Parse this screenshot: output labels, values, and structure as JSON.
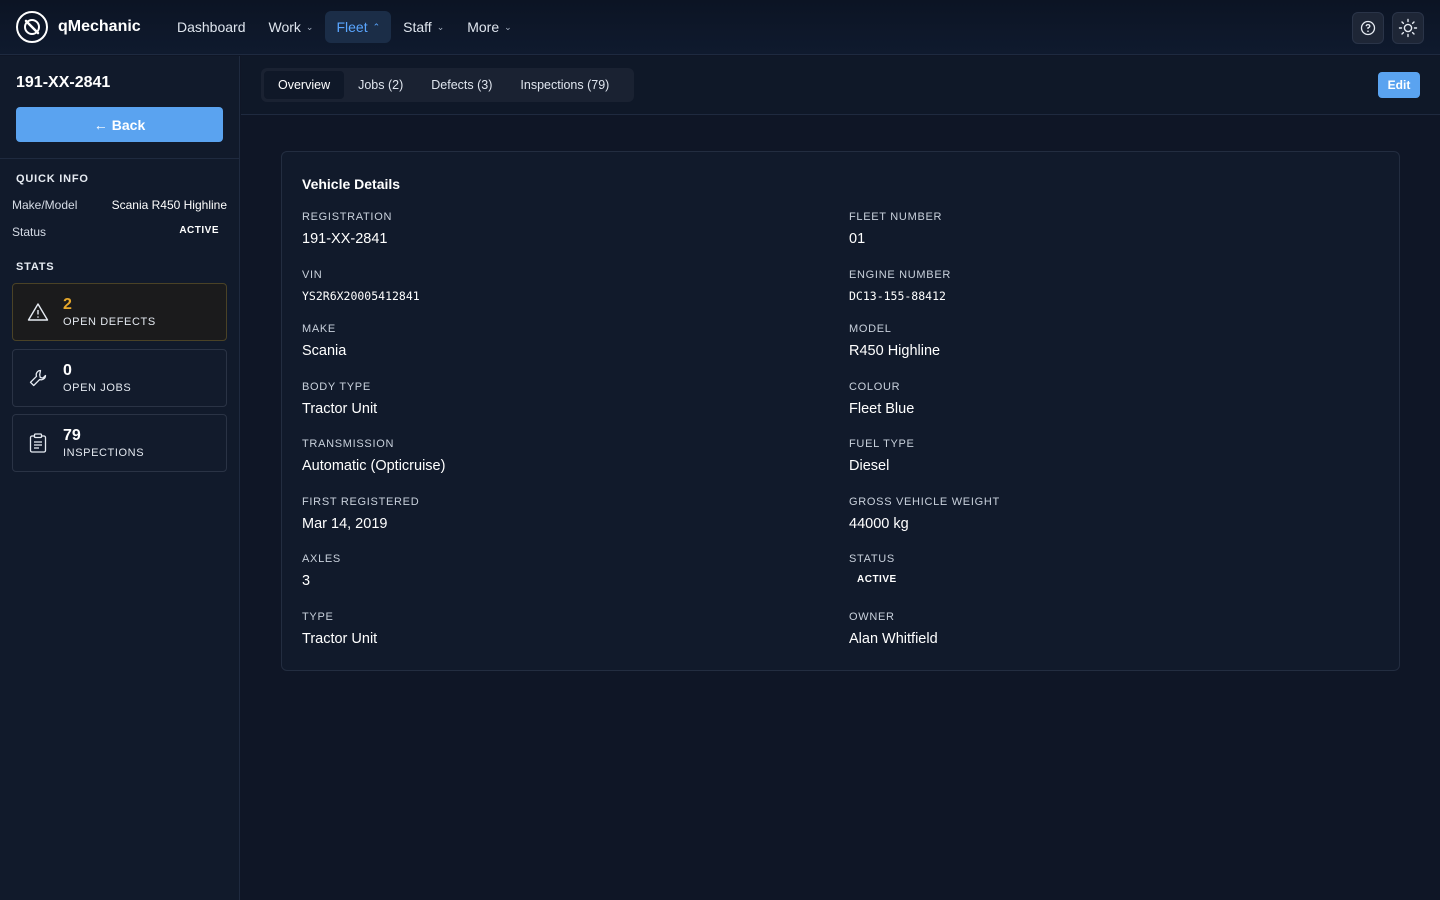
{
  "app": {
    "brand": "qMechanic",
    "nav": [
      {
        "label": "Dashboard",
        "has_menu": false,
        "active": false
      },
      {
        "label": "Work",
        "has_menu": true,
        "active": false
      },
      {
        "label": "Fleet",
        "has_menu": true,
        "active": true
      },
      {
        "label": "Staff",
        "has_menu": true,
        "active": false
      },
      {
        "label": "More",
        "has_menu": true,
        "active": false
      }
    ]
  },
  "sidebar": {
    "title": "191-XX-2841",
    "back_label": "Back",
    "quick_info_heading": "QUICK INFO",
    "quick_info": [
      {
        "key": "Make/Model",
        "value": "Scania R450 Highline"
      },
      {
        "key": "Status",
        "value": "ACTIVE"
      }
    ],
    "stats_heading": "STATS",
    "stats": [
      {
        "number": "2",
        "label": "OPEN DEFECTS",
        "icon": "warning-icon"
      },
      {
        "number": "0",
        "label": "OPEN JOBS",
        "icon": "wrench-icon"
      },
      {
        "number": "79",
        "label": "INSPECTIONS",
        "icon": "clipboard-icon"
      }
    ]
  },
  "tabs": [
    "Overview",
    "Jobs (2)",
    "Defects (3)",
    "Inspections (79)"
  ],
  "active_tab": "Overview",
  "edit_label": "Edit",
  "details": {
    "title": "Vehicle Details",
    "left": [
      {
        "key": "REGISTRATION",
        "value": "191-XX-2841"
      },
      {
        "key": "VIN",
        "value": "YS2R6X20005412841"
      },
      {
        "key": "MAKE",
        "value": "Scania"
      },
      {
        "key": "BODY TYPE",
        "value": "Tractor Unit"
      },
      {
        "key": "TRANSMISSION",
        "value": "Automatic (Opticruise)"
      },
      {
        "key": "FIRST REGISTERED",
        "value": "Mar 14, 2019"
      },
      {
        "key": "AXLES",
        "value": "3"
      },
      {
        "key": "TYPE",
        "value": "Tractor Unit"
      }
    ],
    "right": [
      {
        "key": "FLEET NUMBER",
        "value": "01"
      },
      {
        "key": "ENGINE NUMBER",
        "value": "DC13-155-88412"
      },
      {
        "key": "MODEL",
        "value": "R450 Highline"
      },
      {
        "key": "COLOUR",
        "value": "Fleet Blue"
      },
      {
        "key": "FUEL TYPE",
        "value": "Diesel"
      },
      {
        "key": "GROSS VEHICLE WEIGHT",
        "value": "44000 kg"
      },
      {
        "key": "STATUS",
        "value": "ACTIVE"
      },
      {
        "key": "OWNER",
        "value": "Alan Whitfield"
      }
    ]
  },
  "colors": {
    "accent": "#5aa3f0",
    "warning": "#e6a72a",
    "background": "#0f1626"
  }
}
